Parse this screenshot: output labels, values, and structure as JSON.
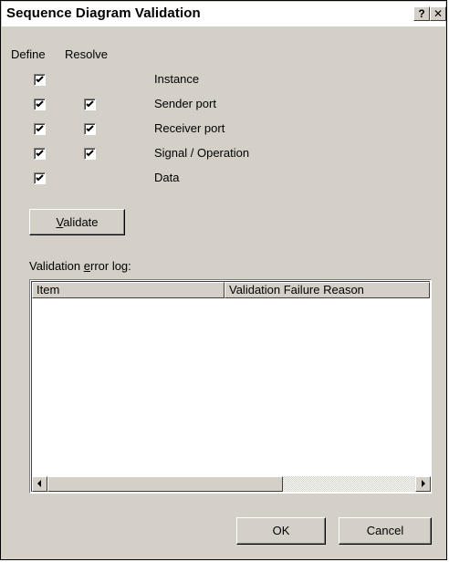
{
  "window": {
    "title": "Sequence Diagram Validation",
    "help_glyph": "?",
    "close_glyph": "✕"
  },
  "headers": {
    "define": "Define",
    "resolve": "Resolve"
  },
  "rows": [
    {
      "label": "Instance",
      "define_checked": true,
      "resolve_checked": null
    },
    {
      "label": "Sender port",
      "define_checked": true,
      "resolve_checked": true
    },
    {
      "label": "Receiver port",
      "define_checked": true,
      "resolve_checked": true
    },
    {
      "label": "Signal / Operation",
      "define_checked": true,
      "resolve_checked": true
    },
    {
      "label": "Data",
      "define_checked": true,
      "resolve_checked": null
    }
  ],
  "validate_button": {
    "mnemonic": "V",
    "rest": "alidate"
  },
  "log_label": {
    "before": "Validation ",
    "mnemonic": "e",
    "after": "rror log:"
  },
  "log_columns": [
    "Item",
    "Validation Failure Reason"
  ],
  "ok_button": "OK",
  "cancel_button": "Cancel",
  "icons": {
    "check": "checkmark-icon",
    "left": "left-arrow-icon",
    "right": "right-arrow-icon"
  }
}
